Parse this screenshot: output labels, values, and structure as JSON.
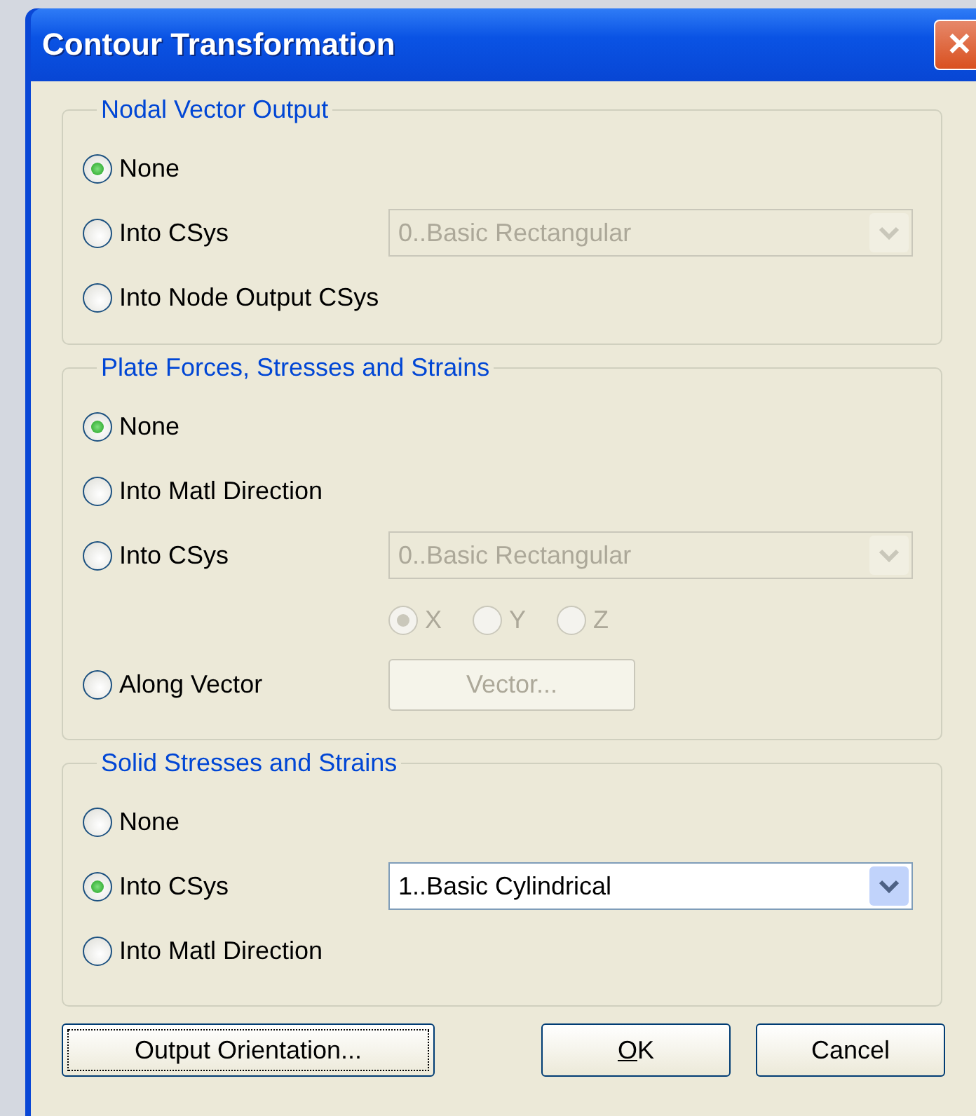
{
  "window": {
    "title": "Contour Transformation",
    "close_label": "✕"
  },
  "groups": [
    {
      "title": "Nodal Vector Output",
      "rows": [
        {
          "kind": "radio",
          "label": "None",
          "selected": true
        },
        {
          "kind": "radio",
          "label": "Into CSys",
          "selected": false,
          "combo": {
            "value": "0..Basic Rectangular",
            "disabled": true
          }
        },
        {
          "kind": "radio",
          "label": "Into Node Output CSys",
          "selected": false
        }
      ]
    },
    {
      "title": "Plate Forces, Stresses and Strains",
      "rows": [
        {
          "kind": "radio",
          "label": "None",
          "selected": true
        },
        {
          "kind": "radio",
          "label": "Into Matl Direction",
          "selected": false
        },
        {
          "kind": "radio",
          "label": "Into CSys",
          "selected": false,
          "combo": {
            "value": "0..Basic Rectangular",
            "disabled": true
          }
        },
        {
          "kind": "axes",
          "disabled": true,
          "axes": [
            {
              "label": "X",
              "selected": true
            },
            {
              "label": "Y",
              "selected": false
            },
            {
              "label": "Z",
              "selected": false
            }
          ]
        },
        {
          "kind": "radio",
          "label": "Along Vector",
          "selected": false,
          "button": {
            "label": "Vector...",
            "disabled": true
          }
        }
      ]
    },
    {
      "title": "Solid Stresses and Strains",
      "rows": [
        {
          "kind": "radio",
          "label": "None",
          "selected": false
        },
        {
          "kind": "radio",
          "label": "Into CSys",
          "selected": true,
          "combo": {
            "value": "1..Basic Cylindrical",
            "disabled": false
          }
        },
        {
          "kind": "radio",
          "label": "Into Matl Direction",
          "selected": false
        }
      ]
    }
  ],
  "buttons": [
    {
      "label": "Output Orientation...",
      "focused": true,
      "underline_first": false
    },
    {
      "label": "OK",
      "focused": false,
      "underline_first": true
    },
    {
      "label": "Cancel",
      "focused": false,
      "underline_first": false
    }
  ]
}
